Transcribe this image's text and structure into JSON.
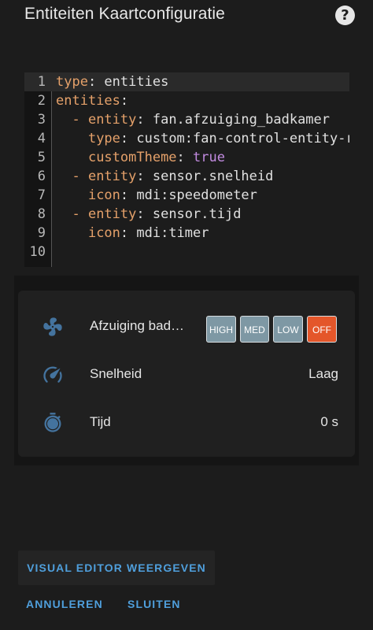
{
  "header": {
    "title": "Entiteiten Kaartconfiguratie",
    "help_icon": "?"
  },
  "editor": {
    "lines": [
      {
        "num": "1",
        "parts": [
          [
            "k",
            "type"
          ],
          [
            "s",
            ": entities"
          ]
        ]
      },
      {
        "num": "2",
        "parts": [
          [
            "k",
            "entities"
          ],
          [
            "s",
            ":"
          ]
        ]
      },
      {
        "num": "3",
        "parts": [
          [
            "s",
            "  "
          ],
          [
            "k",
            "- entity"
          ],
          [
            "s",
            ": fan.afzuiging_badkamer"
          ]
        ]
      },
      {
        "num": "4",
        "parts": [
          [
            "s",
            "    "
          ],
          [
            "k",
            "type"
          ],
          [
            "s",
            ": custom:fan-control-entity-row"
          ]
        ]
      },
      {
        "num": "5",
        "parts": [
          [
            "s",
            "    "
          ],
          [
            "k",
            "customTheme"
          ],
          [
            "s",
            ": "
          ],
          [
            "b",
            "true"
          ]
        ]
      },
      {
        "num": "6",
        "parts": [
          [
            "s",
            "  "
          ],
          [
            "k",
            "- entity"
          ],
          [
            "s",
            ": sensor.snelheid"
          ]
        ]
      },
      {
        "num": "7",
        "parts": [
          [
            "s",
            "    "
          ],
          [
            "k",
            "icon"
          ],
          [
            "s",
            ": mdi:speedometer"
          ]
        ]
      },
      {
        "num": "8",
        "parts": [
          [
            "s",
            "  "
          ],
          [
            "k",
            "- entity"
          ],
          [
            "s",
            ": sensor.tijd"
          ]
        ]
      },
      {
        "num": "9",
        "parts": [
          [
            "s",
            "    "
          ],
          [
            "k",
            "icon"
          ],
          [
            "s",
            ": mdi:timer"
          ]
        ]
      },
      {
        "num": "10",
        "parts": []
      }
    ]
  },
  "preview": {
    "rows": [
      {
        "icon": "fan-icon",
        "name": "Afzuiging bad…",
        "state": ""
      },
      {
        "icon": "speedometer-icon",
        "name": "Snelheid",
        "state": "Laag"
      },
      {
        "icon": "timer-icon",
        "name": "Tijd",
        "state": "0 s"
      }
    ],
    "fan_buttons": [
      {
        "label": "HIGH",
        "color": "#7e98a4"
      },
      {
        "label": "MED",
        "color": "#7e98a4"
      },
      {
        "label": "LOW",
        "color": "#7e98a4"
      },
      {
        "label": "OFF",
        "color": "#e4562a"
      }
    ],
    "icon_color": "#44739e"
  },
  "actions": {
    "visual_editor": "VISUAL EDITOR WEERGEVEN",
    "cancel": "ANNULEREN",
    "close": "SLUITEN"
  }
}
